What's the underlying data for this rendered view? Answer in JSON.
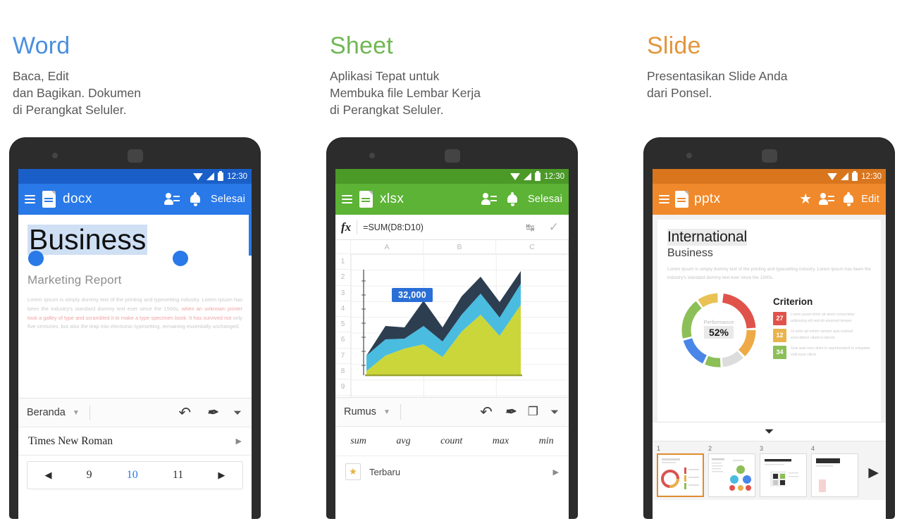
{
  "panels": [
    {
      "headline": "Word",
      "headline_color": "#4a8ee0",
      "subtext": "Baca, Edit\ndan Bagikan. Dokumen\ndi Perangkat Seluler.",
      "app": {
        "accent": "#2979e8",
        "statusbar_color": "#1a5fc8",
        "time": "12:30",
        "extension": "docx",
        "action_label": "Selesai",
        "icons": [
          "menu-icon",
          "document-icon",
          "share-person-icon",
          "bell-icon"
        ]
      },
      "document": {
        "selected_title": "Business",
        "subtitle": "Marketing Report",
        "body_part1": "Lorem Ipsum is simply dummy text of the printing and typesetting industry. Lorem Ipsum has been the industry's standard dummy text ever since the 1500s, ",
        "body_red": "when an unknown printer took a galley of type and scrambled it to make a type specimen book. It has survived not ",
        "body_part2": "only five centuries, but also the leap into electronic typesetting, remaining essentially unchanged."
      },
      "toolbar": {
        "tab_label": "Beranda",
        "icons": [
          "undo-icon",
          "pen-edit-icon",
          "chevron-down-icon"
        ]
      },
      "font_row": {
        "font_name": "Times New Roman"
      },
      "size_row": {
        "prev": "9",
        "current": "10",
        "next": "11"
      }
    },
    {
      "headline": "Sheet",
      "headline_color": "#6fb753",
      "subtext": "Aplikasi Tepat untuk\nMembuka file Lembar Kerja\ndi Perangkat Seluler.",
      "app": {
        "accent": "#5cb335",
        "statusbar_color": "#4b9a28",
        "time": "12:30",
        "extension": "xlsx",
        "action_label": "Selesai",
        "icons": [
          "menu-icon",
          "document-icon",
          "share-person-icon",
          "bell-icon"
        ]
      },
      "formula_bar": {
        "fx_label": "fx",
        "formula": "=SUM(D8:D10)"
      },
      "sheet": {
        "columns": [
          "A",
          "B",
          "C"
        ],
        "rows": [
          "1",
          "2",
          "3",
          "4",
          "5",
          "6",
          "7",
          "8",
          "9"
        ],
        "tooltip_value": "32,000"
      },
      "toolbar": {
        "tab_label": "Rumus",
        "icons": [
          "undo-icon",
          "pen-edit-icon",
          "copy-icon",
          "chevron-down-icon"
        ]
      },
      "functions": [
        "sum",
        "avg",
        "count",
        "max",
        "min"
      ],
      "recent": {
        "label": "Terbaru",
        "icon": "star-document-icon"
      }
    },
    {
      "headline": "Slide",
      "headline_color": "#e2953c",
      "subtext": "Presentasikan Slide Anda\ndari Ponsel.",
      "app": {
        "accent": "#f0892b",
        "statusbar_color": "#d8751d",
        "time": "12:30",
        "extension": "pptx",
        "action_label": "Edit",
        "icons": [
          "menu-icon",
          "document-icon",
          "star-icon",
          "share-person-icon",
          "bell-icon"
        ]
      },
      "slide": {
        "title_highlight": "International",
        "title_second": "Business",
        "body": "Lorem Ipsum is simply dummy text of the printing and typesetting industry. Lorem Ipsum has been the industry's standard dummy text ever since the 1500s.",
        "donut_label": "Performance",
        "donut_value": "52%",
        "criterion_title": "Criterion",
        "criterion_items": [
          {
            "number": "27",
            "color": "#e0534b",
            "text": "Lorem ipsum dolor sit amet consectetur adipiscing elit sed do eiusmod tempor"
          },
          {
            "number": "12",
            "color": "#e9b44c",
            "text": "Ut enim ad minim veniam quis nostrud exercitation ullamco laboris"
          },
          {
            "number": "34",
            "color": "#8cbf57",
            "text": "Duis aute irure dolor in reprehenderit in voluptate velit esse cillum"
          }
        ]
      },
      "thumbnails": [
        {
          "number": "1",
          "selected": true
        },
        {
          "number": "2",
          "selected": false
        },
        {
          "number": "3",
          "selected": false
        },
        {
          "number": "4",
          "selected": false
        }
      ],
      "play_label": "▶"
    }
  ],
  "chart_data": [
    {
      "type": "area",
      "title": "",
      "stacked": true,
      "x": [
        0,
        1,
        2,
        3,
        4,
        5,
        6,
        7,
        8
      ],
      "series": [
        {
          "name": "lime",
          "color": "#cbd63a",
          "values": [
            2,
            14,
            18,
            20,
            14,
            26,
            34,
            24,
            44
          ]
        },
        {
          "name": "cyan",
          "color": "#49bce0",
          "values": [
            8,
            14,
            8,
            16,
            12,
            16,
            20,
            16,
            24
          ]
        },
        {
          "name": "navy",
          "color": "#2c3e50",
          "values": [
            8,
            12,
            10,
            20,
            12,
            22,
            14,
            24,
            14
          ]
        }
      ],
      "annotation": "32,000",
      "xlabel": "",
      "ylabel": "",
      "grid": false,
      "legend": "none"
    },
    {
      "type": "pie",
      "title": "Performance",
      "center_label": "52%",
      "labels": [
        "red",
        "orange",
        "grey",
        "green-light",
        "blue",
        "green",
        "yellow"
      ],
      "values": [
        22,
        12,
        10,
        7,
        13,
        18,
        18
      ],
      "colors": [
        "#e0534b",
        "#edaa47",
        "#dcdcdc",
        "#8cbf57",
        "#4a86e8",
        "#8cbf57",
        "#e9c255"
      ],
      "donut": true,
      "legend": "none"
    }
  ]
}
